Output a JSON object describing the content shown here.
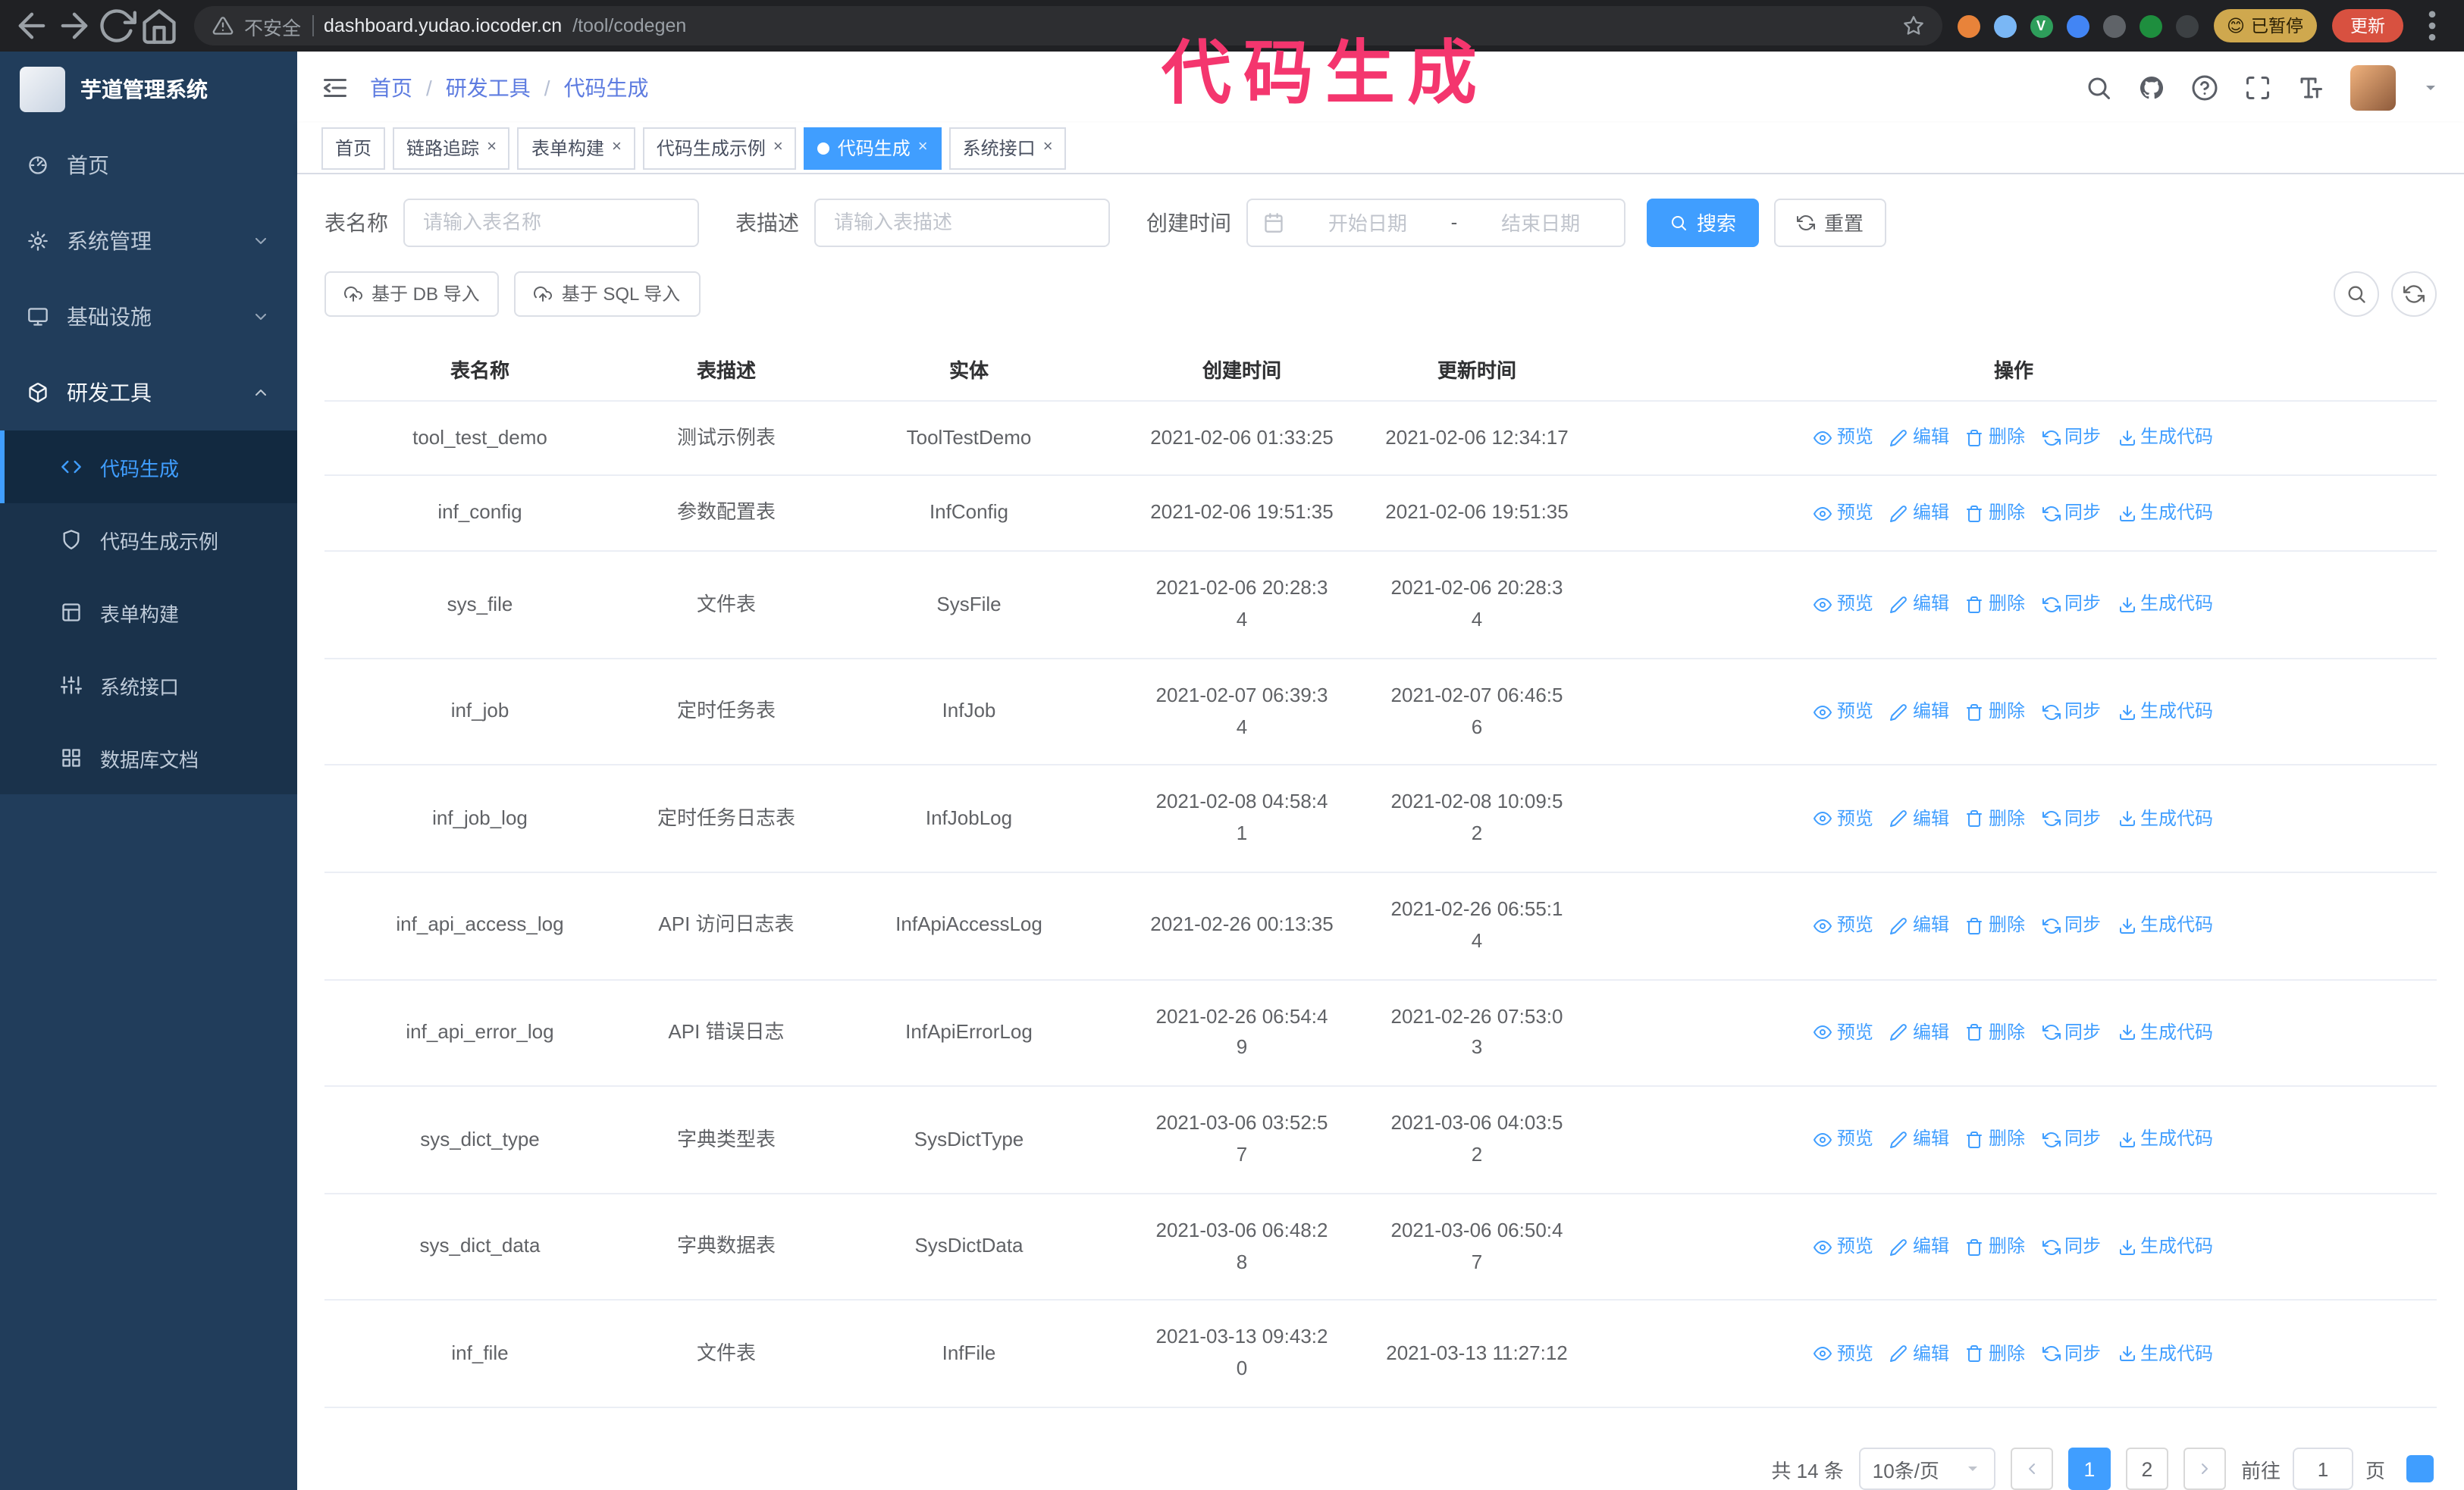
{
  "colors": {
    "accent": "#409eff",
    "annotation": "#f4366e",
    "update_button_bg": "#d85140",
    "sidebar_bg": "#213d5b",
    "sidebar_submenu_bg": "#1a324b",
    "sidebar_active_bg": "#122940"
  },
  "annotation": {
    "text": "代码生成"
  },
  "browser": {
    "security_label": "不安全",
    "url_domain": "dashboard.yudao.iocoder.cn",
    "url_path": "/tool/codegen",
    "paused_emoji": "😊",
    "paused_badge": "已暂停",
    "update_button": "更新",
    "extensions": [
      {
        "color": "#e8833a",
        "label": ""
      },
      {
        "color": "#7ab7f5",
        "label": ""
      },
      {
        "color": "#2e9e5b",
        "label": "V"
      },
      {
        "color": "#4285f4",
        "label": ""
      },
      {
        "color": "#5f6368",
        "label": ""
      },
      {
        "color": "#1e8e3e",
        "label": ""
      },
      {
        "color": "#3c4043",
        "label": ""
      }
    ]
  },
  "sidebar": {
    "logo_title": "芋道管理系统",
    "items": [
      {
        "name": "home",
        "label": "首页",
        "icon": "dashboard-icon",
        "kind": "root"
      },
      {
        "name": "system-management",
        "label": "系统管理",
        "icon": "gear-icon",
        "kind": "root",
        "chevron": "down"
      },
      {
        "name": "infrastructure",
        "label": "基础设施",
        "icon": "monitor-icon",
        "kind": "root",
        "chevron": "down"
      },
      {
        "name": "dev-tools",
        "label": "研发工具",
        "icon": "toolbox-icon",
        "kind": "root",
        "chevron": "up",
        "expanded": true
      },
      {
        "name": "code-generation",
        "label": "代码生成",
        "icon": "code-icon",
        "kind": "sub",
        "active": true
      },
      {
        "name": "code-generation-example",
        "label": "代码生成示例",
        "icon": "shield-icon",
        "kind": "sub"
      },
      {
        "name": "form-builder",
        "label": "表单构建",
        "icon": "form-icon",
        "kind": "sub"
      },
      {
        "name": "system-api",
        "label": "系统接口",
        "icon": "sliders-icon",
        "kind": "sub"
      },
      {
        "name": "database-doc",
        "label": "数据库文档",
        "icon": "grid-icon",
        "kind": "sub"
      }
    ]
  },
  "header": {
    "breadcrumb": [
      {
        "name": "home",
        "label": "首页"
      },
      {
        "name": "dev-tools",
        "label": "研发工具"
      },
      {
        "name": "code-generation",
        "label": "代码生成"
      }
    ]
  },
  "tabs": [
    {
      "name": "home",
      "label": "首页",
      "closable": false,
      "active": false
    },
    {
      "name": "link-trace",
      "label": "链路追踪",
      "closable": true,
      "active": false
    },
    {
      "name": "form-builder",
      "label": "表单构建",
      "closable": true,
      "active": false
    },
    {
      "name": "codegen-example",
      "label": "代码生成示例",
      "closable": true,
      "active": false
    },
    {
      "name": "codegen",
      "label": "代码生成",
      "closable": true,
      "active": true
    },
    {
      "name": "system-api",
      "label": "系统接口",
      "closable": true,
      "active": false
    }
  ],
  "filters": {
    "table_name_label": "表名称",
    "table_name_placeholder": "请输入表名称",
    "table_desc_label": "表描述",
    "table_desc_placeholder": "请输入表描述",
    "create_time_label": "创建时间",
    "start_placeholder": "开始日期",
    "range_separator": "-",
    "end_placeholder": "结束日期",
    "search_button": "搜索",
    "reset_button": "重置"
  },
  "toolbar": {
    "import_db": "基于 DB 导入",
    "import_sql": "基于 SQL 导入"
  },
  "table": {
    "columns": [
      {
        "key": "name",
        "label": "表名称"
      },
      {
        "key": "desc",
        "label": "表描述"
      },
      {
        "key": "entity",
        "label": "实体"
      },
      {
        "key": "created",
        "label": "创建时间"
      },
      {
        "key": "updated",
        "label": "更新时间"
      },
      {
        "key": "actions",
        "label": "操作"
      }
    ],
    "actions": [
      {
        "name": "preview",
        "label": "预览",
        "icon": "eye-icon"
      },
      {
        "name": "edit",
        "label": "编辑",
        "icon": "edit-icon"
      },
      {
        "name": "delete",
        "label": "删除",
        "icon": "delete-icon"
      },
      {
        "name": "sync",
        "label": "同步",
        "icon": "sync-icon"
      },
      {
        "name": "generate-code",
        "label": "生成代码",
        "icon": "generate-icon"
      }
    ],
    "rows": [
      {
        "name": "tool_test_demo",
        "desc": "测试示例表",
        "entity": "ToolTestDemo",
        "created": "2021-02-06 01:33:25",
        "updated": "2021-02-06 12:34:17"
      },
      {
        "name": "inf_config",
        "desc": "参数配置表",
        "entity": "InfConfig",
        "created": "2021-02-06 19:51:35",
        "updated": "2021-02-06 19:51:35"
      },
      {
        "name": "sys_file",
        "desc": "文件表",
        "entity": "SysFile",
        "created": "2021-02-06 20:28:3\n4",
        "updated": "2021-02-06 20:28:3\n4"
      },
      {
        "name": "inf_job",
        "desc": "定时任务表",
        "entity": "InfJob",
        "created": "2021-02-07 06:39:3\n4",
        "updated": "2021-02-07 06:46:5\n6"
      },
      {
        "name": "inf_job_log",
        "desc": "定时任务日志表",
        "entity": "InfJobLog",
        "created": "2021-02-08 04:58:4\n1",
        "updated": "2021-02-08 10:09:5\n2"
      },
      {
        "name": "inf_api_access_log",
        "desc": "API 访问日志表",
        "entity": "InfApiAccessLog",
        "created": "2021-02-26 00:13:35",
        "updated": "2021-02-26 06:55:1\n4"
      },
      {
        "name": "inf_api_error_log",
        "desc": "API 错误日志",
        "entity": "InfApiErrorLog",
        "created": "2021-02-26 06:54:4\n9",
        "updated": "2021-02-26 07:53:0\n3"
      },
      {
        "name": "sys_dict_type",
        "desc": "字典类型表",
        "entity": "SysDictType",
        "created": "2021-03-06 03:52:5\n7",
        "updated": "2021-03-06 04:03:5\n2"
      },
      {
        "name": "sys_dict_data",
        "desc": "字典数据表",
        "entity": "SysDictData",
        "created": "2021-03-06 06:48:2\n8",
        "updated": "2021-03-06 06:50:4\n7"
      },
      {
        "name": "inf_file",
        "desc": "文件表",
        "entity": "InfFile",
        "created": "2021-03-13 09:43:2\n0",
        "updated": "2021-03-13 11:27:12"
      }
    ]
  },
  "pagination": {
    "total_text": "共 14 条",
    "page_size_text": "10条/页",
    "pages": [
      "1",
      "2"
    ],
    "active_page": "1",
    "goto_label": "前往",
    "goto_value": "1",
    "goto_suffix": "页"
  }
}
